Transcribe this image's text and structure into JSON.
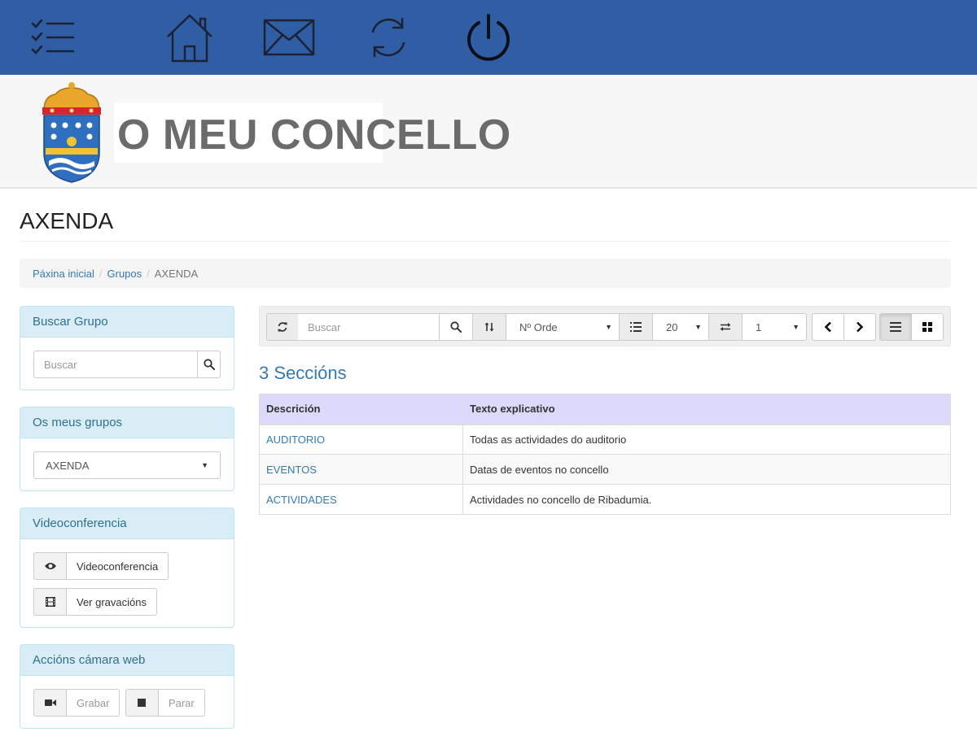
{
  "colors": {
    "topbar": "#305ea4",
    "link": "#337ab7",
    "panel_head": "#d9edf7",
    "table_head": "#dcd9fb"
  },
  "topbar": {
    "icons": [
      "checklist-menu-icon",
      "home-icon",
      "mail-icon",
      "refresh-icon",
      "power-icon"
    ]
  },
  "header": {
    "brand": "O MEU CONCELLO"
  },
  "page": {
    "title": "AXENDA"
  },
  "breadcrumb": {
    "items": [
      "Páxina inicial",
      "Grupos"
    ],
    "current": "AXENDA"
  },
  "sidebar": {
    "search_group": {
      "title": "Buscar Grupo",
      "placeholder": "Buscar"
    },
    "my_groups": {
      "title": "Os meus grupos",
      "selected": "AXENDA"
    },
    "videoconference": {
      "title": "Videoconferencia",
      "buttons": [
        "Videoconferencia",
        "Ver gravacións"
      ]
    },
    "webcam": {
      "title": "Accións cámara web",
      "buttons": [
        "Grabar",
        "Parar"
      ]
    }
  },
  "toolbar": {
    "search_placeholder": "Buscar",
    "order_by": "Nº Orde",
    "page_size": "20",
    "page": "1"
  },
  "content": {
    "count_label": "3 Seccións",
    "columns": [
      "Descrición",
      "Texto explicativo"
    ],
    "rows": [
      [
        "AUDITORIO",
        "Todas as actividades do auditorio"
      ],
      [
        "EVENTOS",
        "Datas de eventos no concello"
      ],
      [
        "ACTIVIDADES",
        "Actividades no concello de Ribadumia."
      ]
    ]
  }
}
